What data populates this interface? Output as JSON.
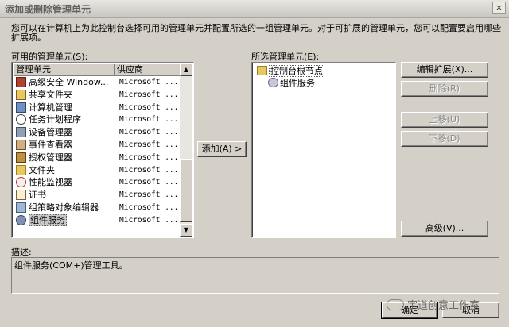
{
  "window": {
    "title": "添加或删除管理单元",
    "close_glyph": "×"
  },
  "description_text": "您可以在计算机上为此控制台选择可用的管理单元并配置所选的一组管理单元。对于可扩展的管理单元，您可以配置要启用哪些扩展项。",
  "available": {
    "label": "可用的管理单元(S):",
    "columns": [
      "管理单元",
      "供应商"
    ],
    "items": [
      {
        "name": "高级安全 Window...",
        "vendor": "Microsoft ...",
        "icon": "firewall-icon"
      },
      {
        "name": "共享文件夹",
        "vendor": "Microsoft ...",
        "icon": "shared-folder-icon"
      },
      {
        "name": "计算机管理",
        "vendor": "Microsoft ...",
        "icon": "computer-management-icon"
      },
      {
        "name": "任务计划程序",
        "vendor": "Microsoft ...",
        "icon": "clock-icon"
      },
      {
        "name": "设备管理器",
        "vendor": "Microsoft ...",
        "icon": "device-manager-icon"
      },
      {
        "name": "事件查看器",
        "vendor": "Microsoft ...",
        "icon": "event-viewer-icon"
      },
      {
        "name": "授权管理器",
        "vendor": "Microsoft ...",
        "icon": "authorization-manager-icon"
      },
      {
        "name": "文件夹",
        "vendor": "Microsoft ...",
        "icon": "folder-icon"
      },
      {
        "name": "性能监视器",
        "vendor": "Microsoft ...",
        "icon": "performance-monitor-icon"
      },
      {
        "name": "证书",
        "vendor": "Microsoft ...",
        "icon": "certificate-icon"
      },
      {
        "name": "组策略对象编辑器",
        "vendor": "Microsoft ...",
        "icon": "group-policy-icon"
      },
      {
        "name": "组件服务",
        "vendor": "Microsoft ...",
        "icon": "component-services-icon",
        "selected": true
      }
    ]
  },
  "add_button": "添加(A) >",
  "selected": {
    "label": "所选管理单元(E):",
    "root": "控制台根节点",
    "child": "组件服务"
  },
  "buttons": {
    "edit_extensions": "编辑扩展(X)...",
    "remove": "删除(R)",
    "move_up": "上移(U)",
    "move_down": "下移(D)",
    "advanced": "高级(V)...",
    "ok": "确定",
    "cancel": "取消"
  },
  "description": {
    "label": "描述:",
    "text": "组件服务(COM+)管理工具。"
  },
  "watermark": "宇道创意工作室",
  "colors": {
    "dialog_bg": "#d4d0c8",
    "list_bg": "#ffffff",
    "selection": "#c8c8c8"
  }
}
